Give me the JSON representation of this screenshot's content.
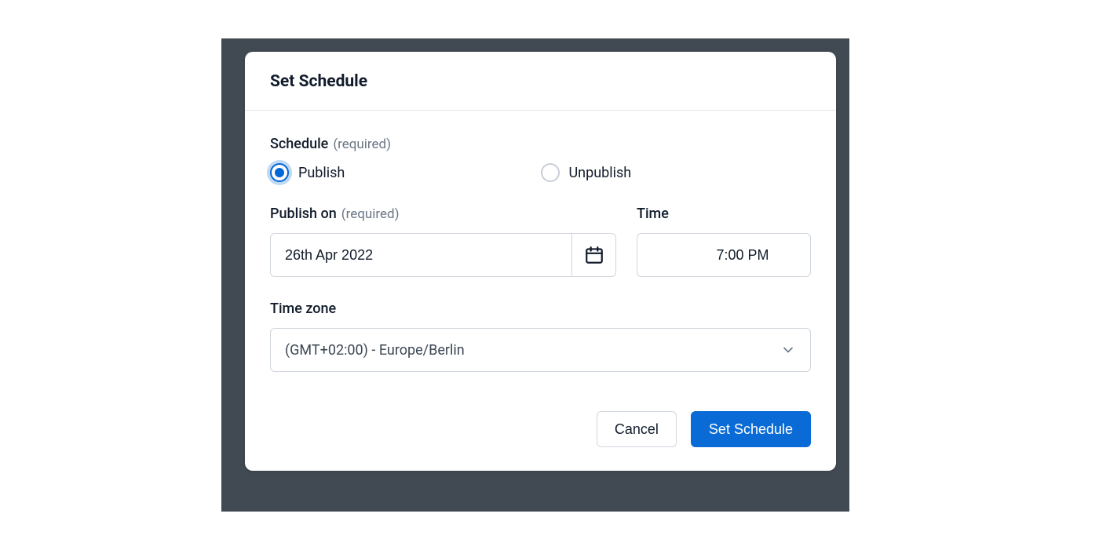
{
  "dialog": {
    "title": "Set Schedule",
    "schedule": {
      "label": "Schedule",
      "required_text": "(required)",
      "options": {
        "publish": "Publish",
        "unpublish": "Unpublish"
      },
      "selected": "publish"
    },
    "publish_on": {
      "label": "Publish on",
      "required_text": "(required)",
      "value": "26th Apr 2022"
    },
    "time": {
      "label": "Time",
      "value": "7:00 PM"
    },
    "timezone": {
      "label": "Time zone",
      "value": "(GMT+02:00) - Europe/Berlin"
    },
    "buttons": {
      "cancel": "Cancel",
      "submit": "Set Schedule"
    }
  }
}
